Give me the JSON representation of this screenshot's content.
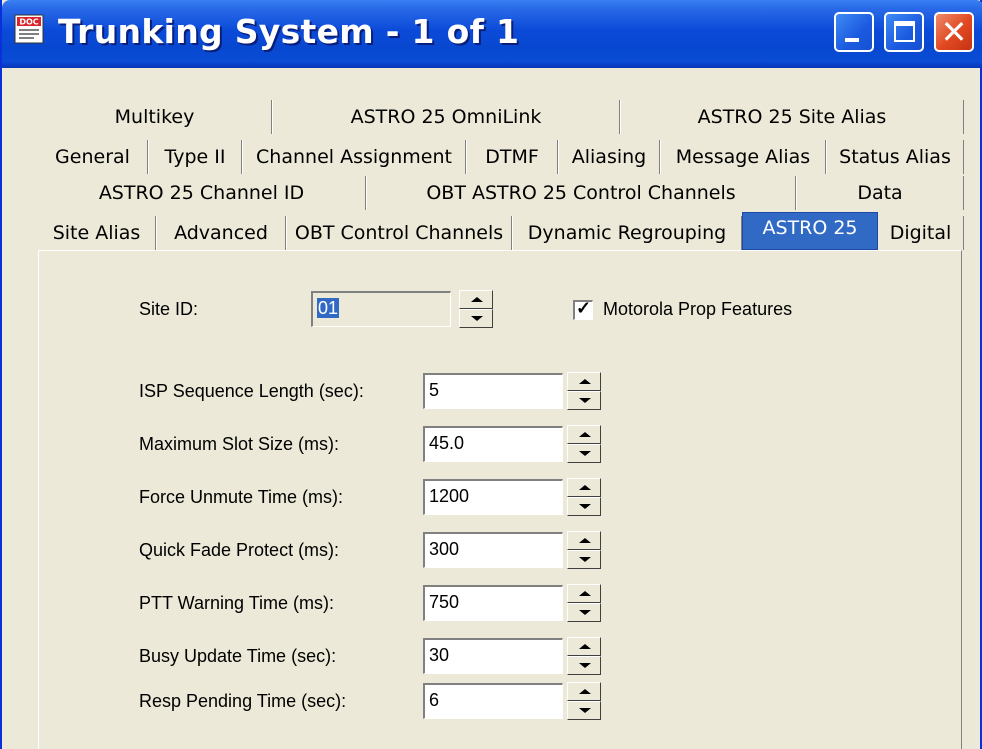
{
  "window": {
    "title": "Trunking System - 1 of 1"
  },
  "tabs": {
    "row1": [
      "Multikey",
      "ASTRO 25 OmniLink",
      "ASTRO 25 Site Alias"
    ],
    "row2": [
      "General",
      "Type II",
      "Channel Assignment",
      "DTMF",
      "Aliasing",
      "Message Alias",
      "Status Alias"
    ],
    "row3": [
      "ASTRO 25 Channel ID",
      "OBT ASTRO 25 Control Channels",
      "Data"
    ],
    "row4": [
      "Site Alias",
      "Advanced",
      "OBT Control Channels",
      "Dynamic Regrouping",
      "ASTRO 25",
      "Digital"
    ],
    "active": "ASTRO 25"
  },
  "form": {
    "site_id": {
      "label": "Site ID:",
      "value": "01"
    },
    "motorola_prop": {
      "label": "Motorola Prop Features",
      "checked": true
    },
    "fields": [
      {
        "label": "ISP Sequence Length (sec):",
        "value": "5"
      },
      {
        "label": "Maximum Slot Size (ms):",
        "value": "45.0"
      },
      {
        "label": "Force Unmute Time (ms):",
        "value": "1200"
      },
      {
        "label": "Quick Fade Protect (ms):",
        "value": "300"
      },
      {
        "label": "PTT Warning Time (ms):",
        "value": "750"
      },
      {
        "label": "Busy Update Time (sec):",
        "value": "30"
      },
      {
        "label": "Resp Pending Time (sec):",
        "value": "6"
      }
    ]
  },
  "colors": {
    "titlebar": "#0a4ad8",
    "face": "#ece9d8",
    "selection": "#316ac5",
    "close": "#e0481f"
  }
}
